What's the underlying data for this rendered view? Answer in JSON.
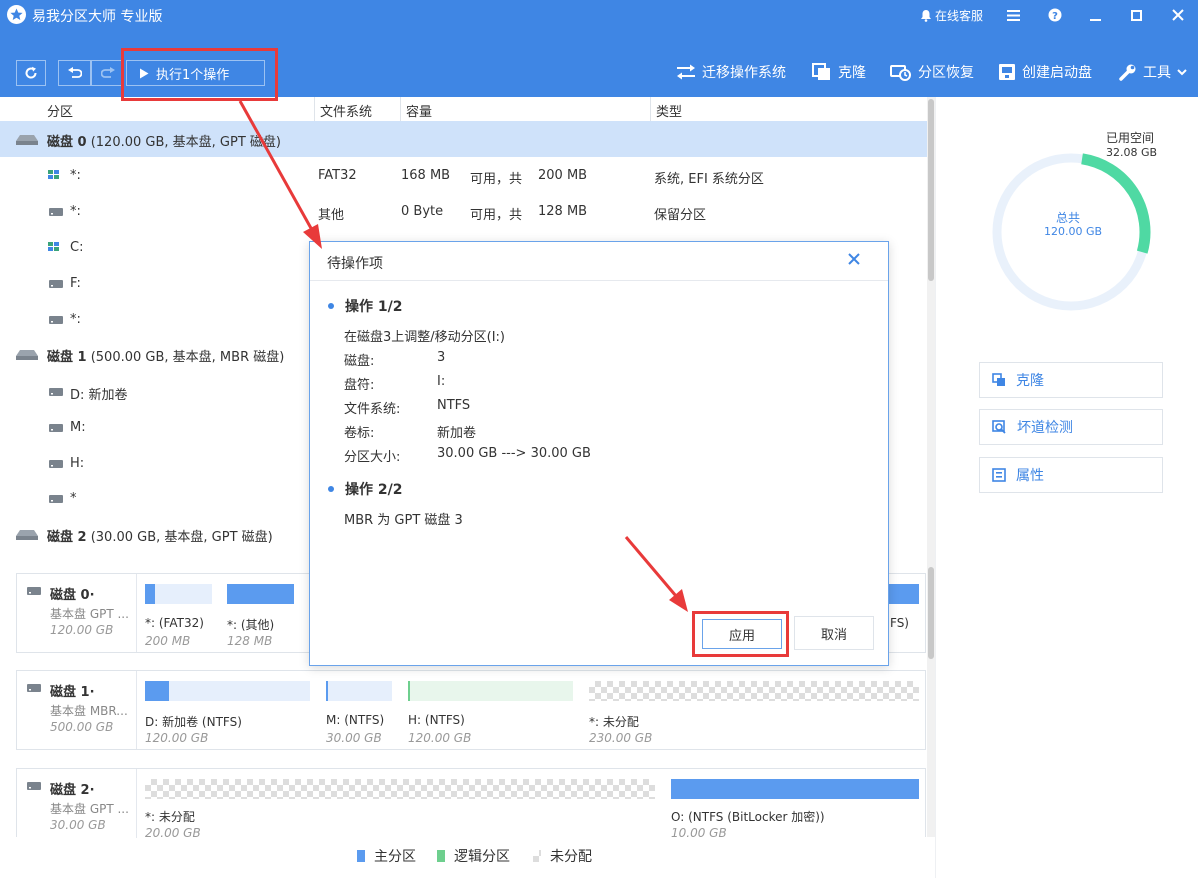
{
  "app": {
    "title": "易我分区大师 专业版",
    "service": "在线客服"
  },
  "toolbar": {
    "execute_label": "执行1个操作",
    "migrate_os": "迁移操作系统",
    "clone": "克隆",
    "recover": "分区恢复",
    "bootdisk": "创建启动盘",
    "tools": "工具"
  },
  "table": {
    "headers": {
      "partition": "分区",
      "fs": "文件系统",
      "capacity": "容量",
      "type": "类型"
    },
    "disk0": {
      "name": "磁盘 0",
      "info": "(120.00 GB, 基本盘, GPT 磁盘)"
    },
    "disk1": {
      "name": "磁盘 1",
      "info": "(500.00 GB, 基本盘, MBR 磁盘)"
    },
    "disk2": {
      "name": "磁盘 2",
      "info": "(30.00 GB, 基本盘, GPT 磁盘)"
    },
    "rows": [
      {
        "name": "*:",
        "fs": "FAT32",
        "free": "168 MB",
        "avail": "可用，共",
        "total": "200 MB",
        "type": "系统, EFI 系统分区"
      },
      {
        "name": "*:",
        "fs": "其他",
        "free": "0 Byte",
        "avail": "可用，共",
        "total": "128 MB",
        "type": "保留分区"
      },
      {
        "name": "C:"
      },
      {
        "name": "F:"
      },
      {
        "name": "*:"
      },
      {
        "name": "D: 新加卷"
      },
      {
        "name": "M:"
      },
      {
        "name": "H:"
      },
      {
        "name": "*"
      }
    ]
  },
  "maps": {
    "disk0": {
      "title": "磁盘 0·",
      "sub1": "基本盘 GPT ...",
      "sub2": "120.00 GB",
      "segs": [
        {
          "label": "*:  (FAT32)",
          "size": "200 MB"
        },
        {
          "label": "*:  (其他)",
          "size": "128 MB"
        },
        {
          "label": "FS)"
        }
      ]
    },
    "disk1": {
      "title": "磁盘 1·",
      "sub1": "基本盘 MBR...",
      "sub2": "500.00 GB",
      "segs": [
        {
          "label": "D: 新加卷 (NTFS)",
          "size": "120.00 GB"
        },
        {
          "label": "M:  (NTFS)",
          "size": "30.00 GB"
        },
        {
          "label": "H:  (NTFS)",
          "size": "120.00 GB"
        },
        {
          "label": "*: 未分配",
          "size": "230.00 GB"
        }
      ]
    },
    "disk2": {
      "title": "磁盘 2·",
      "sub1": "基本盘 GPT ...",
      "sub2": "30.00 GB",
      "segs": [
        {
          "label": "*: 未分配",
          "size": "20.00 GB"
        },
        {
          "label": "O:  (NTFS (BitLocker 加密))",
          "size": "10.00 GB"
        }
      ]
    }
  },
  "legend": {
    "primary": "主分区",
    "logical": "逻辑分区",
    "unalloc": "未分配"
  },
  "side": {
    "used_label": "已用空间",
    "used_value": "32.08 GB",
    "total_label": "总共",
    "total_value": "120.00 GB",
    "used_fraction": 0.27,
    "clone": "克隆",
    "badsector": "坏道检测",
    "props": "属性"
  },
  "dialog": {
    "title": "待操作项",
    "op1": {
      "head": "操作 1/2",
      "desc": "在磁盘3上调整/移动分区(I:)",
      "disk_k": "磁盘:",
      "disk_v": "3",
      "letter_k": "盘符:",
      "letter_v": "I:",
      "fs_k": "文件系统:",
      "fs_v": "NTFS",
      "label_k": "卷标:",
      "label_v": "新加卷",
      "size_k": "分区大小:",
      "size_v": "30.00 GB ---> 30.00 GB"
    },
    "op2": {
      "head": "操作 2/2",
      "desc": "MBR 为 GPT 磁盘 3"
    },
    "apply": "应用",
    "cancel": "取消"
  },
  "colors": {
    "accent": "#3f86e4",
    "primary": "#5b9bef",
    "logical": "#6ecf8e",
    "highlight": "#e83a3a"
  }
}
